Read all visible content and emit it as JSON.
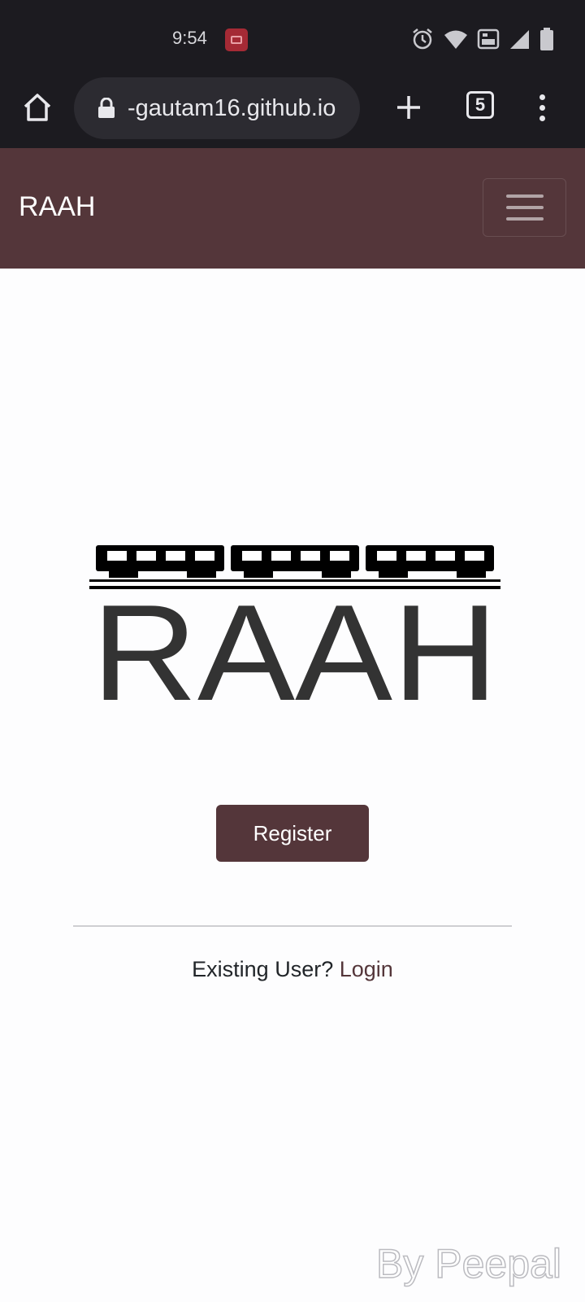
{
  "status_bar": {
    "time": "9:54",
    "icons": [
      "alarm-icon",
      "wifi-icon",
      "volte-icon",
      "signal-icon",
      "battery-icon"
    ]
  },
  "browser": {
    "url": "-gautam16.github.io",
    "tab_count": "5"
  },
  "navbar": {
    "brand": "RAAH",
    "background": "#54363a"
  },
  "main": {
    "logo_text": "RAAH",
    "register_label": "Register",
    "existing_user_text": "Existing User?",
    "login_label": "Login"
  },
  "watermark": "By Peepal"
}
